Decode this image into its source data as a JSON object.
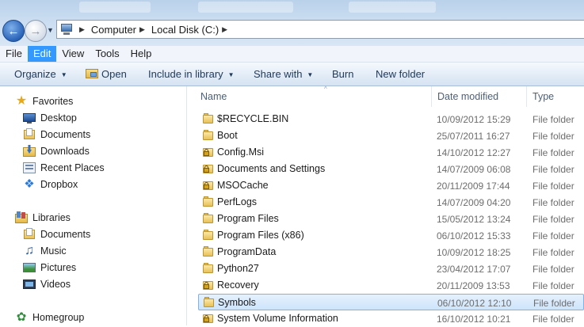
{
  "address": {
    "crumbs": [
      "Computer",
      "Local Disk (C:)"
    ]
  },
  "menu": [
    "File",
    "Edit",
    "View",
    "Tools",
    "Help"
  ],
  "menu_active": "Edit",
  "commands": {
    "organize": "Organize",
    "open": "Open",
    "include": "Include in library",
    "share": "Share with",
    "burn": "Burn",
    "new_folder": "New folder"
  },
  "nav": {
    "favorites": "Favorites",
    "favorite_items": [
      "Desktop",
      "Documents",
      "Downloads",
      "Recent Places",
      "Dropbox"
    ],
    "libraries": "Libraries",
    "library_items": [
      "Documents",
      "Music",
      "Pictures",
      "Videos"
    ],
    "homegroup": "Homegroup"
  },
  "columns": {
    "name": "Name",
    "date": "Date modified",
    "type": "Type"
  },
  "files": [
    {
      "name": "$RECYCLE.BIN",
      "date": "10/09/2012 15:29",
      "type": "File folder",
      "locked": false
    },
    {
      "name": "Boot",
      "date": "25/07/2011 16:27",
      "type": "File folder",
      "locked": false
    },
    {
      "name": "Config.Msi",
      "date": "14/10/2012 12:27",
      "type": "File folder",
      "locked": true
    },
    {
      "name": "Documents and Settings",
      "date": "14/07/2009 06:08",
      "type": "File folder",
      "locked": true
    },
    {
      "name": "MSOCache",
      "date": "20/11/2009 17:44",
      "type": "File folder",
      "locked": true
    },
    {
      "name": "PerfLogs",
      "date": "14/07/2009 04:20",
      "type": "File folder",
      "locked": false
    },
    {
      "name": "Program Files",
      "date": "15/05/2012 13:24",
      "type": "File folder",
      "locked": false
    },
    {
      "name": "Program Files (x86)",
      "date": "06/10/2012 15:33",
      "type": "File folder",
      "locked": false
    },
    {
      "name": "ProgramData",
      "date": "10/09/2012 18:25",
      "type": "File folder",
      "locked": false
    },
    {
      "name": "Python27",
      "date": "23/04/2012 17:07",
      "type": "File folder",
      "locked": false
    },
    {
      "name": "Recovery",
      "date": "20/11/2009 13:53",
      "type": "File folder",
      "locked": true
    },
    {
      "name": "Symbols",
      "date": "06/10/2012 12:10",
      "type": "File folder",
      "locked": false,
      "selected": true
    },
    {
      "name": "System Volume Information",
      "date": "16/10/2012 10:21",
      "type": "File folder",
      "locked": true
    }
  ]
}
